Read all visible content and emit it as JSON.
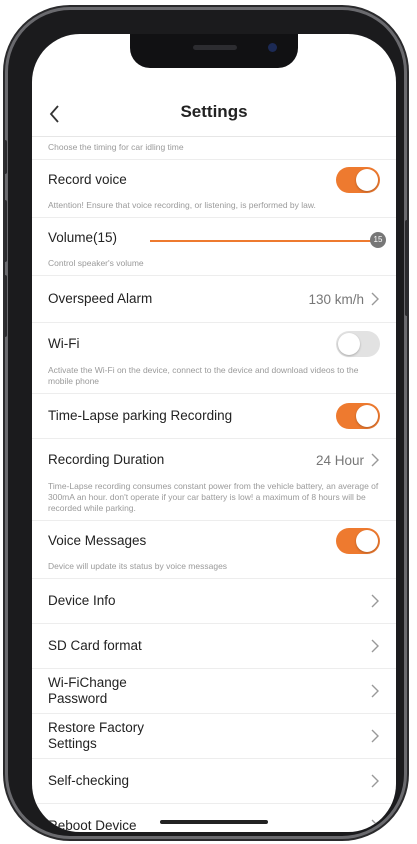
{
  "header": {
    "title": "Settings"
  },
  "notes": {
    "idling": "Choose the timing for car idling time",
    "record_voice_attention": "Attention! Ensure that voice recording, or listening, is performed by law.",
    "volume_note": "Control speaker's volume",
    "wifi_note": "Activate the Wi-Fi on the device, connect to the device and download videos to the mobile phone",
    "timelapse_note": "Time-Lapse recording consumes constant power from the vehicle battery, an average of 300mA an hour. don't operate if your car battery is low! a maximum of 8 hours will be recorded while parking.",
    "voice_messages_note": "Device will update its status by voice messages"
  },
  "settings": {
    "record_voice": {
      "label": "Record voice",
      "enabled": true
    },
    "volume": {
      "label": "Volume(15)",
      "value": "15",
      "level": 1.0
    },
    "overspeed": {
      "label": "Overspeed Alarm",
      "value": "130 km/h"
    },
    "wifi": {
      "label": "Wi-Fi",
      "enabled": false
    },
    "timelapse": {
      "label": "Time-Lapse parking Recording",
      "enabled": true
    },
    "duration": {
      "label": "Recording Duration",
      "value": "24 Hour"
    },
    "voice_messages": {
      "label": "Voice Messages",
      "enabled": true
    }
  },
  "menu": {
    "device_info": "Device Info",
    "sd_format": "SD Card format",
    "wifi_change_password_1": "Wi-FiChange",
    "wifi_change_password_2": "Password",
    "restore_factory_1": "Restore Factory",
    "restore_factory_2": "Settings",
    "self_checking": "Self-checking",
    "reboot": "Reboot Device"
  },
  "colors": {
    "accent": "#ee7a2f",
    "toggle_off": "#e2e2e2"
  }
}
